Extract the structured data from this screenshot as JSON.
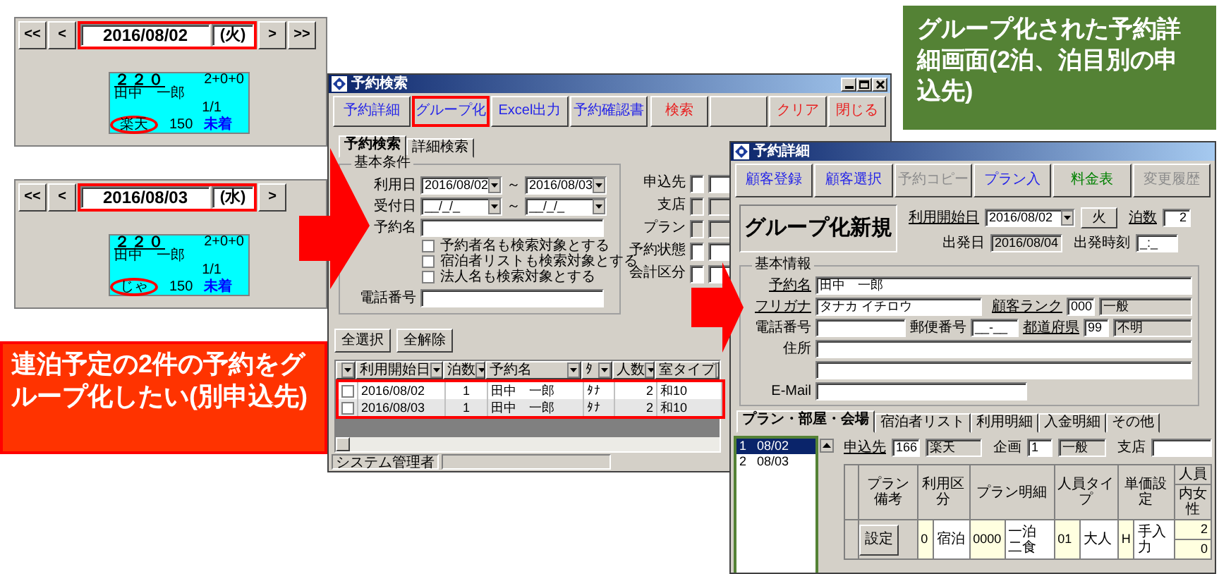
{
  "calendar_panels": [
    {
      "prev_buttons": [
        "<<",
        "<"
      ],
      "date": "2016/08/02",
      "weekday": "(火)",
      "highlighted": true,
      "next_buttons": [
        ">",
        ">>"
      ],
      "booking": {
        "room": "２２０",
        "guests": "2+0+0",
        "guest_name": "田中　一郎",
        "nights": "1/1",
        "agent": "楽天",
        "agent_circled": true,
        "amount": "150",
        "status": "未着"
      }
    },
    {
      "prev_buttons": [
        "<<",
        "<"
      ],
      "date": "2016/08/03",
      "weekday": "(水)",
      "highlighted": true,
      "next_buttons": [
        ">"
      ],
      "booking": {
        "room": "２２０",
        "guests": "2+0+0",
        "guest_name": "田中　一郎",
        "nights": "1/1",
        "agent": "じゃ",
        "agent_circled": true,
        "amount": "150",
        "status": "未着"
      }
    }
  ],
  "callouts": [
    {
      "kind": "alert",
      "text": "連泊予定の2件の予約をグループ化したい(別申込先)"
    },
    {
      "kind": "info",
      "text": "グループ化された予約詳細画面(2泊、泊目別の申込先)"
    }
  ],
  "search_window": {
    "title": "予約検索",
    "toolbar": [
      {
        "label": "予約詳細",
        "kind": "blue",
        "highlighted": false
      },
      {
        "label": "グループ化",
        "kind": "blue",
        "highlighted": true
      },
      {
        "label": "Excel出力",
        "kind": "blue",
        "highlighted": false
      },
      {
        "label": "予約確認書",
        "kind": "blue",
        "highlighted": false
      }
    ],
    "toolbar_right": [
      {
        "label": "検索",
        "kind": "red"
      },
      {
        "kind": "blank"
      },
      {
        "label": "クリア",
        "kind": "red"
      },
      {
        "label": "閉じる",
        "kind": "red"
      }
    ],
    "tabs": [
      {
        "label": "予約検索",
        "selected": true
      },
      {
        "label": "詳細検索",
        "selected": false
      }
    ],
    "conditions": {
      "legend": "基本条件",
      "date_ranges": [
        {
          "label": "利用日",
          "from": "2016/08/02",
          "separator": "～",
          "to": "2016/08/03"
        },
        {
          "label": "受付日",
          "from": "__/_/_",
          "separator": "～",
          "to": "__/_/_"
        }
      ],
      "name_label": "予約名",
      "options": [
        {
          "label": "予約者名も検索対象とする",
          "checked": false
        },
        {
          "label": "宿泊者リストも検索対象とする",
          "checked": false
        },
        {
          "label": "法人名も検索対象とする",
          "checked": false
        }
      ],
      "phone_label": "電話番号"
    },
    "filters": [
      {
        "label": "申込先",
        "readonly": false
      },
      {
        "label": "支店",
        "readonly": true
      },
      {
        "label": "プラン",
        "readonly": true
      },
      {
        "label": "予約状態",
        "readonly": false
      },
      {
        "label": "会計区分",
        "readonly": false
      }
    ],
    "select_buttons": [
      "全選択",
      "全解除"
    ],
    "grid": {
      "columns": [
        "利用開始日",
        "泊数",
        "予約名",
        "ﾀ",
        "人数",
        "室タイプ"
      ],
      "rows_highlighted": true,
      "rows": [
        {
          "checked": false,
          "cells": [
            "2016/08/02",
            "1",
            "田中　一郎",
            "ﾀﾅ",
            "2",
            "和10"
          ]
        },
        {
          "checked": false,
          "cells": [
            "2016/08/03",
            "1",
            "田中　一郎",
            "ﾀﾅ",
            "2",
            "和10"
          ]
        }
      ]
    },
    "status_bar": "システム管理者"
  },
  "detail_window": {
    "title": "予約詳細",
    "toolbar": [
      {
        "label": "顧客登録",
        "kind": "blue"
      },
      {
        "label": "顧客選択",
        "kind": "blue"
      },
      {
        "label": "予約コピー",
        "kind": "disabled"
      },
      {
        "label": "プラン入",
        "kind": "blue"
      },
      {
        "label": "料金表",
        "kind": "green"
      },
      {
        "label": "変更履歴",
        "kind": "disabled"
      }
    ],
    "mode": "グループ化新規",
    "start_date": {
      "label": "利用開始日",
      "value": "2016/08/02",
      "weekday": "火"
    },
    "nights": {
      "label": "泊数",
      "value": "2"
    },
    "departure": {
      "label": "出発日",
      "value": "2016/08/04"
    },
    "departure_time": {
      "label": "出発時刻",
      "value": "_:_"
    },
    "basic_info": {
      "legend": "基本情報",
      "booking_name": {
        "label": "予約名",
        "value": "田中　一郎"
      },
      "kana": {
        "label": "フリガナ",
        "value": "タナカ イチロウ"
      },
      "customer_rank": {
        "label": "顧客ランク",
        "code": "000",
        "value": "一般"
      },
      "phone": {
        "label": "電話番号"
      },
      "postal_code": {
        "label": "郵便番号",
        "value": "__-__"
      },
      "prefecture": {
        "label": "都道府県",
        "code": "99",
        "value": "不明"
      },
      "address": {
        "label": "住所"
      },
      "email": {
        "label": "E-Mail"
      }
    },
    "tabs": [
      {
        "label": "プラン・部屋・会場",
        "selected": true
      },
      {
        "label": "宿泊者リスト",
        "selected": false
      },
      {
        "label": "利用明細",
        "selected": false
      },
      {
        "label": "入金明細",
        "selected": false
      },
      {
        "label": "その他",
        "selected": false
      }
    ],
    "nights_list": {
      "highlighted": true,
      "items": [
        {
          "label": "1   08/02",
          "selected": true
        },
        {
          "label": "2   08/03",
          "selected": false
        }
      ]
    },
    "applicant": {
      "label": "申込先",
      "code": "166",
      "value": "楽天"
    },
    "plan_type": {
      "label": "企画",
      "code": "1",
      "value": "一般"
    },
    "branch": {
      "label": "支店"
    },
    "plan_grid": {
      "columns": [
        {
          "header": "プラン備考",
          "cells": [
            {
              "kind": "button",
              "text": "設定"
            }
          ]
        },
        {
          "header": "利用区分",
          "cells": [
            {
              "kind": "code",
              "text": "0"
            },
            {
              "kind": "text",
              "text": "宿泊"
            }
          ]
        },
        {
          "header": "プラン明細",
          "cells": [
            {
              "kind": "code",
              "text": "0000"
            },
            {
              "kind": "text",
              "text": "一泊二食"
            }
          ]
        },
        {
          "header": "人員タイプ",
          "cells": [
            {
              "kind": "code",
              "text": "01"
            },
            {
              "kind": "text",
              "text": "大人"
            }
          ]
        },
        {
          "header": "単価設定",
          "cells": [
            {
              "kind": "code",
              "text": "H"
            },
            {
              "kind": "text",
              "text": "手入力"
            }
          ]
        },
        {
          "header": "人員",
          "subheader": "内女性",
          "stacked": true,
          "cells": [
            {
              "kind": "code",
              "text": "2"
            },
            {
              "kind": "code",
              "text": "0"
            }
          ]
        }
      ]
    }
  }
}
